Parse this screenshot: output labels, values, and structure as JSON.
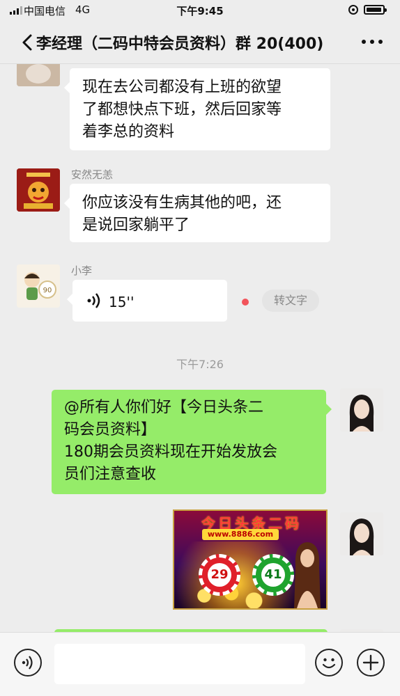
{
  "status_bar": {
    "carrier": "中国电信",
    "network": "4G",
    "time": "下午9:45",
    "icons": [
      "signal-icon",
      "orientation-lock-icon",
      "battery-icon"
    ]
  },
  "nav": {
    "title": "李经理（二码中特会员资料）群 20(400)",
    "back_icon": "chevron-left-icon",
    "more_icon": "more-dots-icon"
  },
  "messages": [
    {
      "side": "left",
      "sender": "",
      "lines": [
        "现在去公司都没有上班的欲望",
        "了都想快点下班，然后回家等",
        "着李总的资料"
      ]
    },
    {
      "side": "left",
      "sender": "安然无恙",
      "lines": [
        "你应该没有生病其他的吧，还",
        "是说回家躺平了"
      ]
    },
    {
      "side": "left",
      "sender": "小李",
      "type": "voice",
      "duration": "15''",
      "unread": true,
      "action_label": "转文字"
    },
    {
      "type": "time",
      "text": "下午7:26"
    },
    {
      "side": "right",
      "lines": [
        "@所有人你们好【今日头条二",
        "码会员资料】",
        "180期会员资料现在开始发放会",
        "员们注意查收"
      ]
    },
    {
      "side": "right",
      "type": "image",
      "image": {
        "title": "今日头条二码",
        "banner": "www.8886.com",
        "numbers": [
          "29",
          "41"
        ]
      }
    }
  ],
  "input_bar": {
    "placeholder": "",
    "icons": [
      "voice-toggle-icon",
      "emoji-icon",
      "plus-icon"
    ]
  },
  "colors": {
    "background": "#ededed",
    "green_bubble": "#95ec69",
    "white_bubble": "#ffffff",
    "unread_dot": "#f2545b",
    "timestamp": "#9b9b9b"
  }
}
